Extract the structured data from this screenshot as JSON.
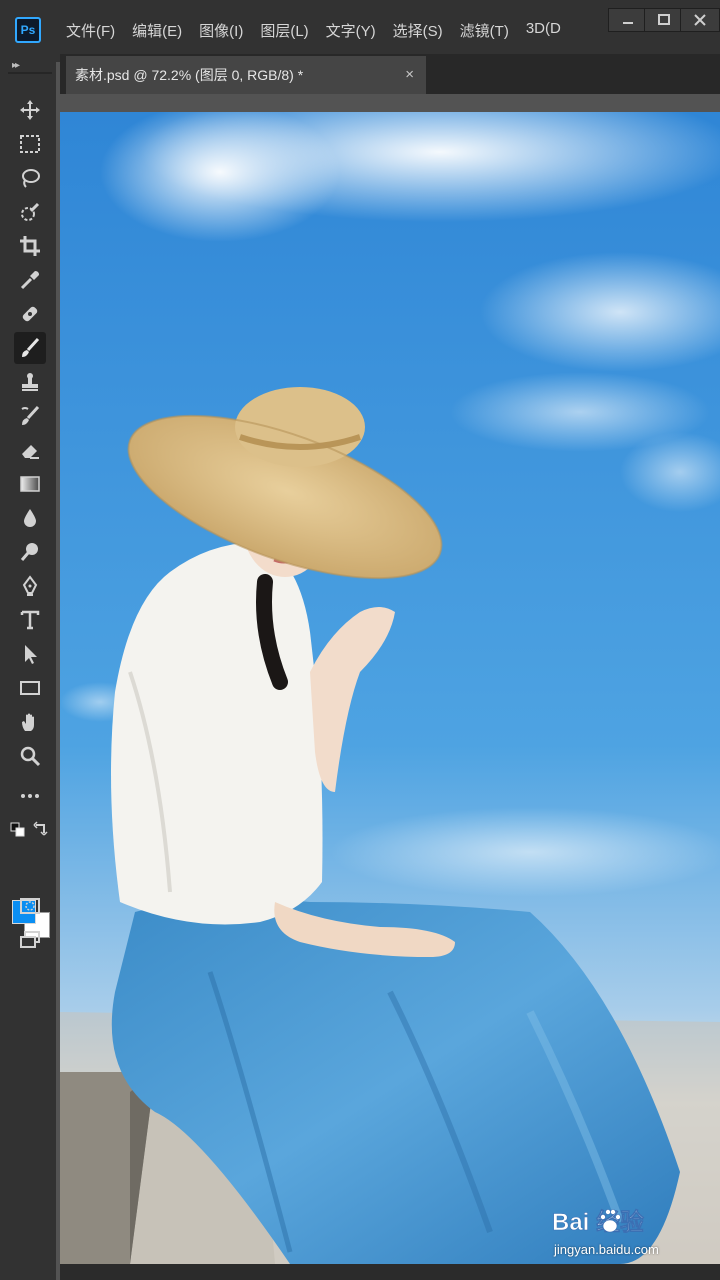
{
  "app": {
    "logo_text": "Ps"
  },
  "menu": [
    "文件(F)",
    "编辑(E)",
    "图像(I)",
    "图层(L)",
    "文字(Y)",
    "选择(S)",
    "滤镜(T)",
    "3D(D"
  ],
  "document_tab": {
    "title": "素材.psd @ 72.2% (图层 0, RGB/8) *",
    "close": "×"
  },
  "toolbar": {
    "grip": "▸▸",
    "tools": [
      {
        "icon": "move-icon"
      },
      {
        "icon": "marquee-icon"
      },
      {
        "icon": "lasso-icon"
      },
      {
        "icon": "quick-selection-icon"
      },
      {
        "icon": "crop-icon"
      },
      {
        "icon": "eyedropper-icon"
      },
      {
        "icon": "healing-brush-icon"
      },
      {
        "icon": "brush-icon",
        "active": true
      },
      {
        "icon": "clone-stamp-icon"
      },
      {
        "icon": "history-brush-icon"
      },
      {
        "icon": "eraser-icon"
      },
      {
        "icon": "gradient-icon"
      },
      {
        "icon": "blur-icon"
      },
      {
        "icon": "dodge-icon"
      },
      {
        "icon": "pen-icon"
      },
      {
        "icon": "type-icon"
      },
      {
        "icon": "path-selection-icon"
      },
      {
        "icon": "rectangle-icon"
      },
      {
        "icon": "hand-icon"
      },
      {
        "icon": "zoom-icon"
      },
      {
        "icon": "more-tools-icon"
      }
    ],
    "foreground_color": "#0a8ef2",
    "background_color": "#ffffff"
  },
  "watermark": {
    "logo_text": "Bai  经验",
    "url": "jingyan.baidu.com"
  }
}
